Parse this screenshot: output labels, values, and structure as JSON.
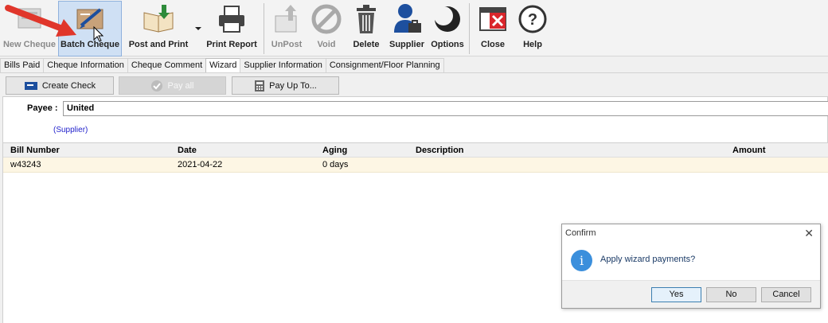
{
  "toolbar": {
    "new_cheque": "New Cheque",
    "batch_cheque": "Batch Cheque",
    "post_and_print": "Post and Print",
    "print_report": "Print Report",
    "unpost": "UnPost",
    "void": "Void",
    "delete": "Delete",
    "supplier": "Supplier",
    "options": "Options",
    "close": "Close",
    "help": "Help"
  },
  "tabs": [
    "Bills Paid",
    "Cheque Information",
    "Cheque Comment",
    "Wizard",
    "Supplier Information",
    "Consignment/Floor Planning"
  ],
  "active_tab": "Wizard",
  "actions": {
    "create_check": "Create Check",
    "pay_all": "Pay all",
    "pay_up_to": "Pay Up To..."
  },
  "payee": {
    "label": "Payee :",
    "value": "United",
    "type": "(Supplier)"
  },
  "grid": {
    "columns": [
      "Bill Number",
      "Date",
      "Aging",
      "Description",
      "Amount"
    ],
    "rows": [
      {
        "bill_number": "w43243",
        "date": "2021-04-22",
        "aging": "0 days",
        "description": "",
        "amount": ""
      }
    ]
  },
  "dialog": {
    "title": "Confirm",
    "message": "Apply wizard payments?",
    "yes": "Yes",
    "no": "No",
    "cancel": "Cancel"
  },
  "colors": {
    "accent_blue": "#3b8fdc",
    "row_highlight": "#fdf6e4",
    "annotation_red": "#e0362b"
  },
  "icons": [
    "new-cheque-icon",
    "batch-cheque-icon",
    "post-and-print-icon",
    "printer-icon",
    "unpost-icon",
    "void-icon",
    "trash-icon",
    "supplier-icon",
    "options-icon",
    "close-icon",
    "help-icon",
    "check-icon",
    "pay-all-icon",
    "calculator-icon",
    "info-icon"
  ]
}
